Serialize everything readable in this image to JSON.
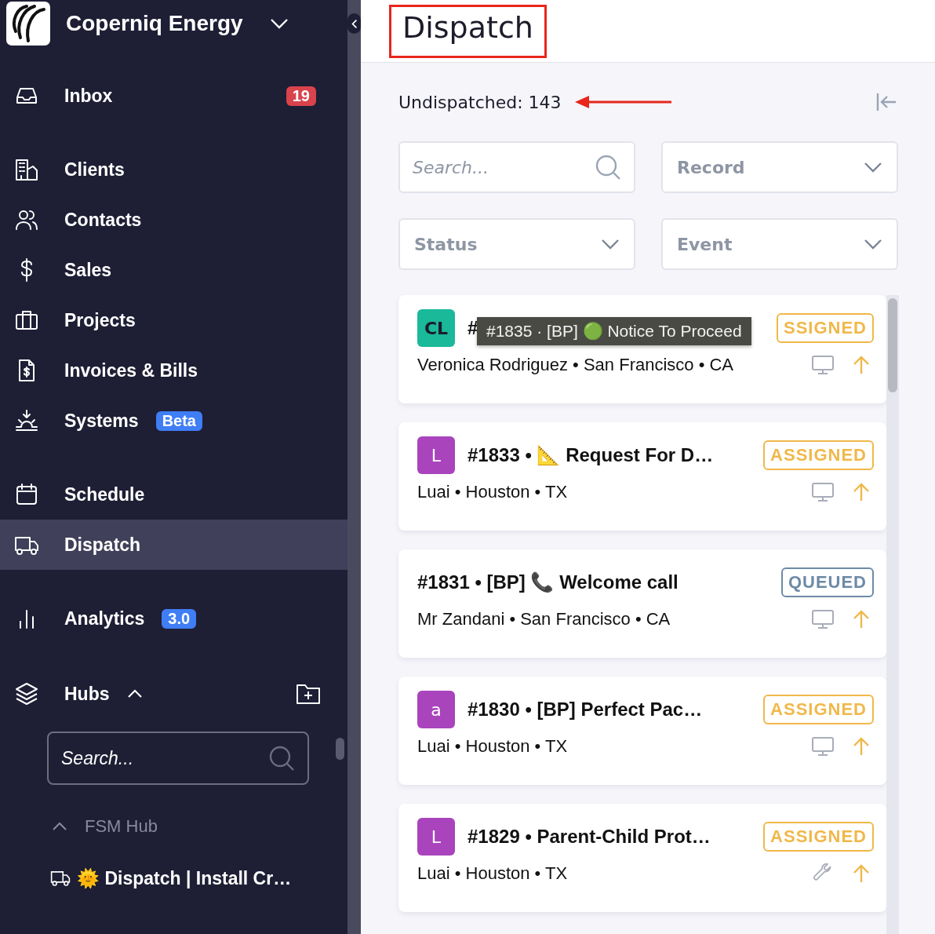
{
  "sidebar": {
    "org_name": "Coperniq Energy",
    "sections": [
      [
        {
          "label": "Inbox",
          "kind": "inbox",
          "badge": {
            "text": "19",
            "kind": "count"
          },
          "selected": false
        }
      ],
      [
        {
          "label": "Clients",
          "kind": "clients",
          "selected": false
        },
        {
          "label": "Contacts",
          "kind": "contacts",
          "selected": false
        },
        {
          "label": "Sales",
          "kind": "sales",
          "selected": false
        },
        {
          "label": "Projects",
          "kind": "projects",
          "selected": false
        },
        {
          "label": "Invoices & Bills",
          "kind": "invoices",
          "selected": false
        },
        {
          "label": "Systems",
          "kind": "systems",
          "badge": {
            "text": "Beta",
            "kind": "tag"
          },
          "selected": false
        }
      ],
      [
        {
          "label": "Schedule",
          "kind": "schedule",
          "selected": false
        },
        {
          "label": "Dispatch",
          "kind": "dispatch",
          "selected": true
        }
      ],
      [
        {
          "label": "Analytics",
          "kind": "analytics",
          "badge": {
            "text": "3.0",
            "kind": "tag"
          },
          "selected": false
        }
      ]
    ],
    "hubs": {
      "label": "Hubs",
      "expanded": true,
      "search_placeholder": "Search...",
      "groups": [
        {
          "label": "FSM Hub",
          "expanded": true,
          "children": [
            {
              "label": "🌞 Dispatch | Install Cr…"
            }
          ]
        }
      ]
    }
  },
  "page": {
    "title": "Dispatch",
    "title_highlighted": true,
    "undispatched": "Undispatched: 143",
    "arrow_annotation": true,
    "search_placeholder": "Search...",
    "filters": [
      "Record",
      "Status",
      "Event"
    ],
    "cards": [
      {
        "avatar": {
          "text": "CL",
          "color": "#19b99a"
        },
        "title": "#",
        "location": "Veronica Rodriguez • San Francisco • CA",
        "status": {
          "text": "SSIGNED",
          "kind": "assigned"
        },
        "kind": "monitor"
      },
      {
        "avatar": {
          "text": "L",
          "color": "#a944bd"
        },
        "title": "#1833 • 📐 Request For D…",
        "location": "Luai • Houston • TX",
        "status": {
          "text": "ASSIGNED",
          "kind": "assigned"
        },
        "kind": "monitor"
      },
      {
        "title": "#1831 • [BP] 📞 Welcome call",
        "location": "Mr Zandani • San Francisco • CA",
        "status": {
          "text": "QUEUED",
          "kind": "queued"
        },
        "kind": "monitor"
      },
      {
        "avatar": {
          "text": "a",
          "color": "#a944bd"
        },
        "title": "#1830 • [BP] Perfect Pac…",
        "location": "Luai • Houston • TX",
        "status": {
          "text": "ASSIGNED",
          "kind": "assigned"
        },
        "kind": "monitor"
      },
      {
        "avatar": {
          "text": "L",
          "color": "#a944bd"
        },
        "title": "#1829 • Parent-Child Prot…",
        "location": "Luai • Houston • TX",
        "status": {
          "text": "ASSIGNED",
          "kind": "assigned"
        },
        "kind": "wrench"
      }
    ],
    "tooltip": "#1835 · [BP] 🟢 Notice To Proceed"
  }
}
